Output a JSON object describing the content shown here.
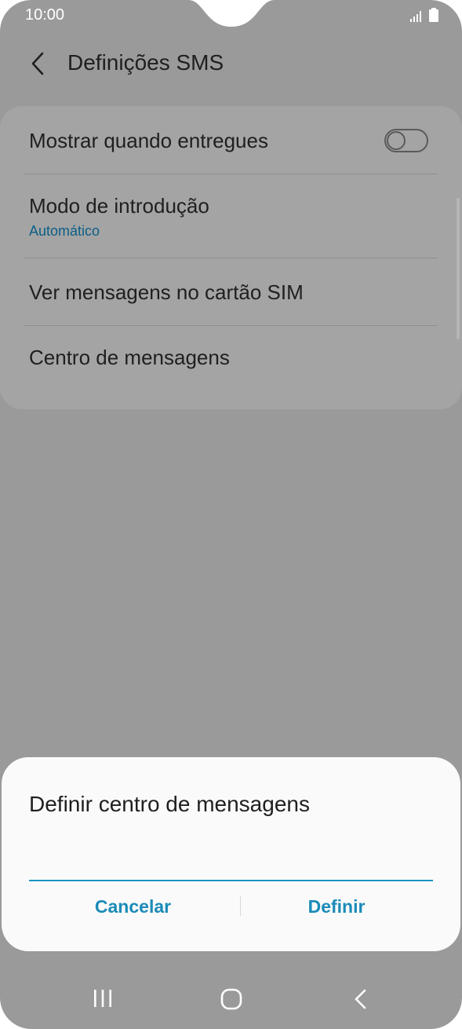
{
  "status_bar": {
    "time": "10:00"
  },
  "header": {
    "title": "Definições SMS",
    "back_icon": "chevron-left-icon"
  },
  "settings": {
    "items": [
      {
        "label": "Mostrar quando entregues",
        "toggle": false
      },
      {
        "label": "Modo de introdução",
        "sub": "Automático"
      },
      {
        "label": "Ver mensagens no cartão SIM"
      },
      {
        "label": "Centro de mensagens"
      }
    ]
  },
  "dialog": {
    "title": "Definir centro de mensagens",
    "input_value": "",
    "cancel_label": "Cancelar",
    "confirm_label": "Definir"
  },
  "colors": {
    "accent": "#1a8bb8",
    "sub_text": "#0b5f86",
    "scrim": "#9a9a9a"
  },
  "navbar": {
    "icons": [
      "recent-apps-icon",
      "home-icon",
      "back-icon"
    ]
  }
}
